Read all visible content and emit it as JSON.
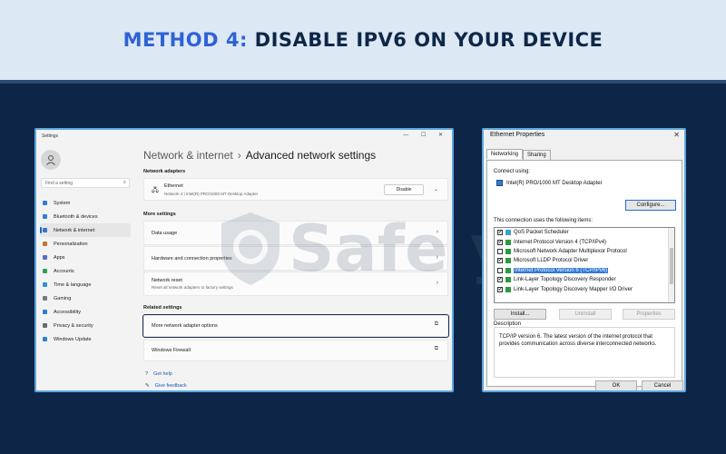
{
  "banner": {
    "method": "METHOD 4:",
    "title": "DISABLE IPV6 ON YOUR DEVICE"
  },
  "settings": {
    "window_title": "Settings",
    "search_placeholder": "Find a setting",
    "nav": [
      {
        "label": "System",
        "color": "#2f7fd8"
      },
      {
        "label": "Bluetooth & devices",
        "color": "#2f7fd8"
      },
      {
        "label": "Network & internet",
        "color": "#3a6fcf"
      },
      {
        "label": "Personalization",
        "color": "#c2762b"
      },
      {
        "label": "Apps",
        "color": "#5b6ad0"
      },
      {
        "label": "Accounts",
        "color": "#2aa05a"
      },
      {
        "label": "Time & language",
        "color": "#2f8fd8"
      },
      {
        "label": "Gaming",
        "color": "#7a7a7a"
      },
      {
        "label": "Accessibility",
        "color": "#2f7fd8"
      },
      {
        "label": "Privacy & security",
        "color": "#6b6b6b"
      },
      {
        "label": "Windows Update",
        "color": "#2f7fd8"
      }
    ],
    "breadcrumb": {
      "parent": "Network & internet",
      "current": "Advanced network settings"
    },
    "network_adapters": {
      "heading": "Network adapters",
      "adapter_name": "Ethernet",
      "adapter_desc": "Network 4 | Intel(R) PRO/1000 MT Desktop Adapter",
      "disable_label": "Disable"
    },
    "more_settings": {
      "heading": "More settings",
      "data_usage": "Data usage",
      "hardware": "Hardware and connection properties",
      "reset": "Network reset",
      "reset_desc": "Reset all network adapters to factory settings"
    },
    "related": {
      "heading": "Related settings",
      "adapter_options": "More network adapter options",
      "firewall": "Windows Firewall"
    },
    "footer": {
      "help": "Get help",
      "feedback": "Give feedback"
    }
  },
  "ethernet": {
    "title": "Ethernet Properties",
    "tabs": [
      "Networking",
      "Sharing"
    ],
    "connect_using": "Connect using:",
    "adapter": "Intel(R) PRO/1000 MT Desktop Adapter",
    "configure": "Configure...",
    "items_label": "This connection uses the following items:",
    "items": [
      {
        "label": "QoS Packet Scheduler",
        "checked": true
      },
      {
        "label": "Internet Protocol Version 4 (TCP/IPv4)",
        "checked": true
      },
      {
        "label": "Microsoft Network Adapter Multiplexor Protocol",
        "checked": false
      },
      {
        "label": "Microsoft LLDP Protocol Driver",
        "checked": true
      },
      {
        "label": "Internet Protocol Version 6 (TCP/IPv6)",
        "checked": false,
        "selected": true
      },
      {
        "label": "Link-Layer Topology Discovery Responder",
        "checked": true
      },
      {
        "label": "Link-Layer Topology Discovery Mapper I/O Driver",
        "checked": true
      }
    ],
    "install": "Install...",
    "uninstall": "Uninstall",
    "properties": "Properties",
    "description_label": "Description",
    "description": "TCP/IP version 6. The latest version of the internet protocol that provides communication across diverse interconnected networks.",
    "ok": "OK",
    "cancel": "Cancel"
  },
  "watermark": {
    "text": "Safe  yo"
  }
}
